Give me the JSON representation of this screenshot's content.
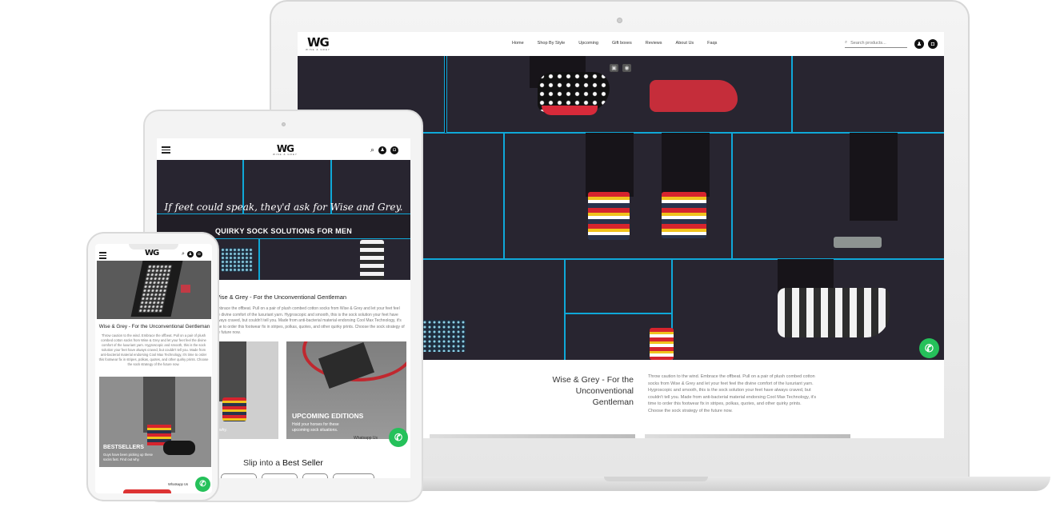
{
  "brand": {
    "logo_text": "WG",
    "logo_tagline": "WISE & GREY"
  },
  "laptop": {
    "menu": [
      "Home",
      "Shop By Style",
      "Upcoming",
      "Gift boxes",
      "Reviews",
      "About Us",
      "Faqs"
    ],
    "search_placeholder": "Search products...",
    "intro_heading": "Wise & Grey - For the Unconventional Gentleman",
    "intro_body": "Throw caution to the wind. Embrace the offbeat. Pull on a pair of plush combed cotton socks from Wise & Grey and let your feet feel the divine comfort of the luxuriant yarn. Hygroscopic and smooth, this is the sock solution your feet have always craved, but couldn't tell you. Made from anti-bacterial material endorsing Cool Max Technology, it's time to order this footwear fix in stripes, polkas, quotes, and other quirky prints. Choose the sock strategy of the future now."
  },
  "tablet": {
    "hero_tagline": "If feet could speak, they'd ask for Wise and Grey.",
    "hero_sub": "QUIRKY SOCK SOLUTIONS FOR MEN",
    "intro_heading": "Wise & Grey - For the Unconventional Gentleman",
    "intro_body": "Embrace the offbeat. Pull on a pair of plush combed cotton socks from Wise & Grey and let your feet feel the divine comfort of the luxuriant yarn. Hygroscopic and smooth, this is the sock solution your feet have always craved, but couldn't tell you. Made from anti-bacterial material endorsing Cool Max Technology, it's time to order this footwear fix in stripes, polkas, quotes, and other quirky prints. Choose the sock strategy of the future now.",
    "card_left_text": "why.",
    "card_heading": "UPCOMING EDITIONS",
    "card_body": "Hold your horses for these upcoming sock situations.",
    "whatsapp_label": "Whatsapp Us",
    "slip_prefix": "Slip into a",
    "slip_bold": "Best Seller"
  },
  "phone": {
    "intro_heading": "Wise & Grey - For the Unconventional Gentleman",
    "intro_body": "Throw caution to the wind. Embrace the offbeat. Pull on a pair of plush combed cotton socks from Wise & Grey and let your feet feel the divine comfort of the luxuriant yarn. Hygroscopic and smooth, this is the sock solution your feet have always craved, but couldn't tell you. Made from anti-bacterial material endorsing Cool Max Technology, it's time to order this footwear fix in stripes, polkas, quotes, and other quirky prints. Choose the sock strategy of the future now.",
    "card_heading": "BESTSELLERS",
    "card_body": "Guys have been picking up these socks fast. Find out why.",
    "whatsapp_label": "Whatsapp Us"
  },
  "icons": {
    "search": "⌕",
    "user": "♟",
    "cart": "◘",
    "whatsapp": "✆"
  },
  "colors": {
    "panel_border": "#0fa8d8",
    "whatsapp": "#25c15a",
    "hero_bg": "#1d1a22"
  }
}
